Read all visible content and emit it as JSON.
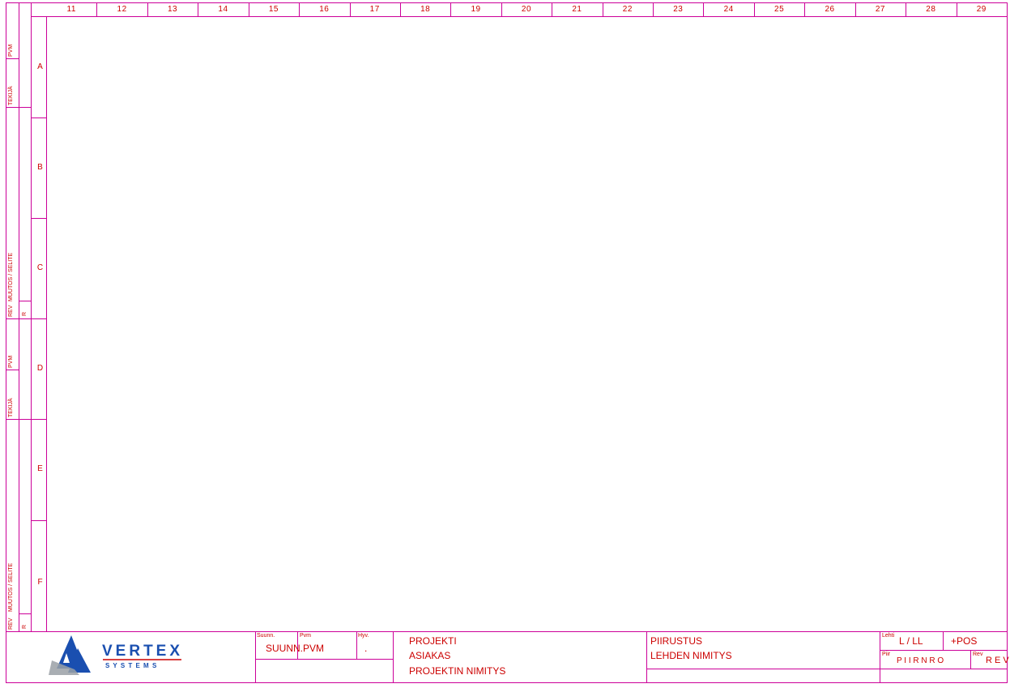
{
  "column_numbers": [
    "11",
    "12",
    "13",
    "14",
    "15",
    "16",
    "17",
    "18",
    "19",
    "20",
    "21",
    "22",
    "23",
    "24",
    "25",
    "26",
    "27",
    "28",
    "29"
  ],
  "row_letters": [
    "A",
    "B",
    "C",
    "D",
    "E",
    "F"
  ],
  "revision_strip": {
    "upper": {
      "pvm": "PVM",
      "tekija": "TEKIJÄ",
      "muutos": "MUUTOS / SELITE",
      "rev": "REV",
      "r": "R"
    },
    "lower": {
      "pvm": "PVM",
      "tekija": "TEKIJÄ",
      "muutos": "MUUTOS / SELITE",
      "rev": "REV",
      "r": "R"
    }
  },
  "logo": {
    "name": "VERTEX",
    "tagline": "S Y S T E M S",
    "colors": {
      "blue": "#1a4fb0",
      "gray": "#9aa0a6",
      "red": "#cc0000"
    }
  },
  "title_block": {
    "suunn_label": "Suunn.",
    "suunn_value": "SUUNN.",
    "pvm_label": "Pvm",
    "pvm_value": "PVM",
    "hyv_label": "Hyv.",
    "hyv_value": ".",
    "projekti": "PROJEKTI",
    "asiakas": "ASIAKAS",
    "projektin_nimitys": "PROJEKTIN NIMITYS",
    "piirustus": "PIIRUSTUS",
    "lehden_nimitys": "LEHDEN NIMITYS",
    "lehti_label": "Lehti",
    "lehti_value": "L / LL",
    "pos_value": "+POS",
    "piir_label": "Piir",
    "piir_value": "P I I R N R O",
    "rev_label": "Rev",
    "rev_value": "R E V"
  },
  "colors": {
    "frame": "#cc0099",
    "text": "#cc0000"
  }
}
